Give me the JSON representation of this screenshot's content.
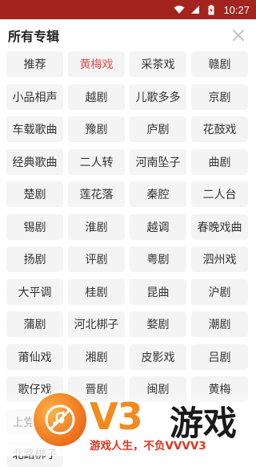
{
  "status_bar": {
    "time": "10:27",
    "icons": [
      "wifi-icon",
      "signal-icon",
      "battery-charging-icon"
    ],
    "background": "#a3241e"
  },
  "header": {
    "title": "所有专辑",
    "close_icon": "close-icon"
  },
  "tags": [
    "推荐",
    "黄梅戏",
    "采茶戏",
    "赣剧",
    "小品相声",
    "越剧",
    "儿歌多多",
    "京剧",
    "车载歌曲",
    "豫剧",
    "庐剧",
    "花鼓戏",
    "经典歌曲",
    "二人转",
    "河南坠子",
    "曲剧",
    "楚剧",
    "莲花落",
    "秦腔",
    "二人台",
    "锡剧",
    "淮剧",
    "越调",
    "春晚戏曲",
    "扬剧",
    "评剧",
    "粤剧",
    "泗州戏",
    "大平调",
    "桂剧",
    "昆曲",
    "沪剧",
    "蒲剧",
    "河北梆子",
    "婺剧",
    "潮剧",
    "莆仙戏",
    "湘剧",
    "皮影戏",
    "吕剧",
    "歌仔戏",
    "晋剧",
    "闽剧",
    "黄梅",
    "上党梆子",
    "",
    "",
    "",
    "北路梆子",
    "",
    "",
    ""
  ],
  "active_tag": "黄梅戏",
  "colors": {
    "active_text": "#e0504a",
    "tag_bg": "#f4f4f4"
  },
  "watermark": {
    "brand": "V3",
    "word": "游戏",
    "slogan": "游戏人生，不负VVVV3"
  }
}
